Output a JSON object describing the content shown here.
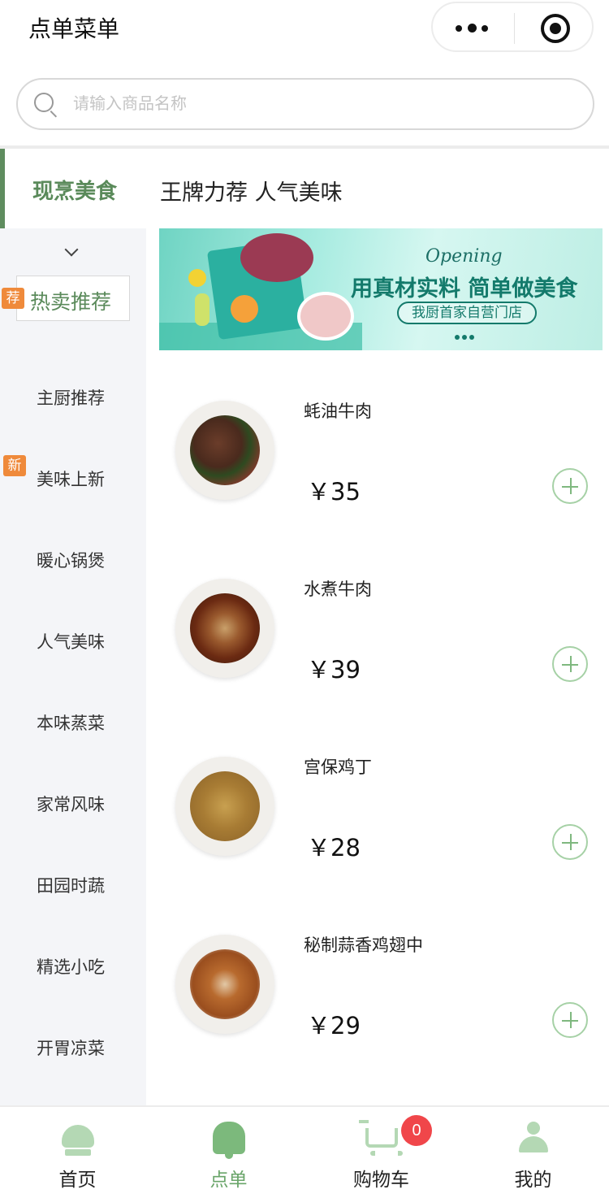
{
  "header": {
    "title": "点单菜单"
  },
  "search": {
    "placeholder": "请输入商品名称"
  },
  "sidebar": {
    "heading": "现烹美食",
    "items": [
      {
        "label": "热卖推荐",
        "tag": "荐",
        "active": true
      },
      {
        "label": "主厨推荐"
      },
      {
        "label": "美味上新",
        "tag": "新"
      },
      {
        "label": "暖心锅煲"
      },
      {
        "label": "人气美味"
      },
      {
        "label": "本味蒸菜"
      },
      {
        "label": "家常风味"
      },
      {
        "label": "田园时蔬"
      },
      {
        "label": "精选小吃"
      },
      {
        "label": "开胃凉菜"
      }
    ]
  },
  "main": {
    "section_title": "王牌力荐 人气美味",
    "banner": {
      "script_text": "Opening",
      "headline": "用真材实料 简单做美食",
      "store_label": "我厨首家自营门店"
    },
    "dishes": [
      {
        "name": "蚝油牛肉",
        "price": "￥35"
      },
      {
        "name": "水煮牛肉",
        "price": "￥39"
      },
      {
        "name": "宫保鸡丁",
        "price": "￥28"
      },
      {
        "name": "秘制蒜香鸡翅中",
        "price": "￥29"
      }
    ]
  },
  "tabbar": {
    "tabs": [
      {
        "label": "首页",
        "icon": "chef-hat-icon"
      },
      {
        "label": "点单",
        "icon": "bell-icon",
        "active": true
      },
      {
        "label": "购物车",
        "icon": "cart-icon"
      },
      {
        "label": "我的",
        "icon": "person-icon"
      }
    ],
    "cart_badge": "0"
  },
  "colors": {
    "accent": "#5a8a5a",
    "tag": "#ef8a3b",
    "badge": "#f0464a"
  }
}
